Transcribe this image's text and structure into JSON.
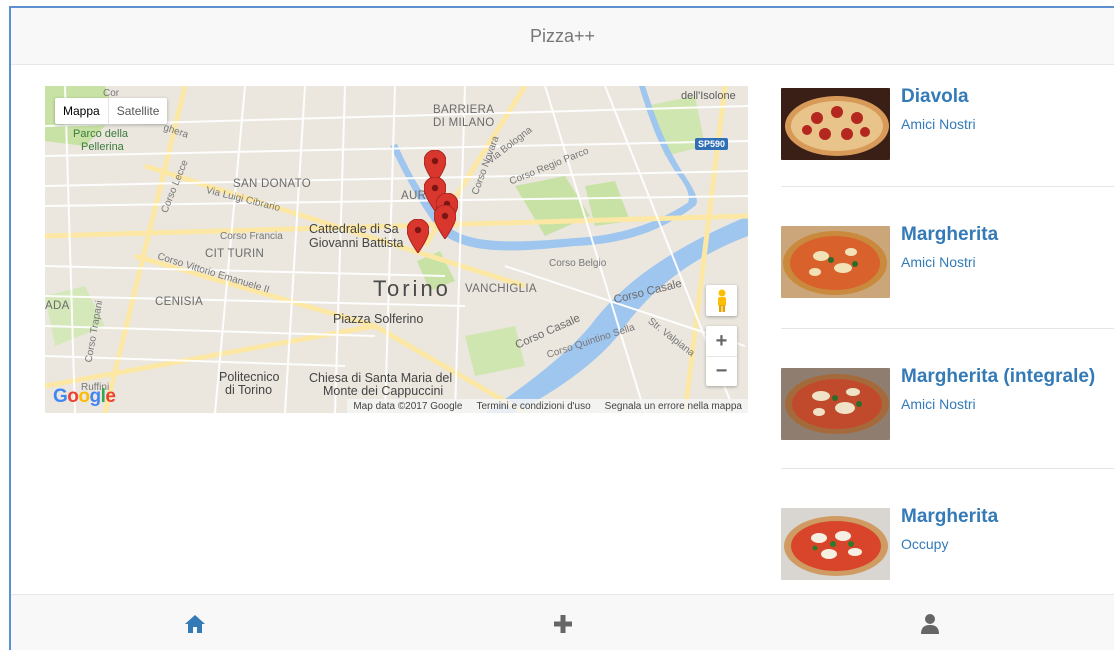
{
  "header": {
    "title": "Pizza++"
  },
  "map": {
    "type_controls": {
      "map_label": "Mappa",
      "satellite_label": "Satellite"
    },
    "zoom": {
      "in": "+",
      "out": "−"
    },
    "attribution": {
      "data": "Map data ©2017 Google",
      "terms": "Termini e condizioni d'uso",
      "report": "Segnala un errore nella mappa"
    },
    "labels": {
      "city": "Torino",
      "barriera": "BARRIERA",
      "di_milano": "DI MILANO",
      "san_donato": "SAN DONATO",
      "aurora": "AURO",
      "cattedrale": "Cattedrale di Sa",
      "giovanni": "Giovanni Battista",
      "cit_turin": "CIT TURIN",
      "cenisia": "CENISIA",
      "vanchiglia": "VANCHIGLIA",
      "piazza_solferino": "Piazza Solferino",
      "politecnico_1": "Politecnico",
      "politecnico_2": "di Torino",
      "chiesa_1": "Chiesa di Santa Maria del",
      "chiesa_2": "Monte dei Cappuccini",
      "parco_1": "Parco della",
      "parco_2": "Pellerina",
      "isolone": "dell'Isolone",
      "sp590": "SP590",
      "corso_lecce": "Corso Lecce",
      "via_luigi_cibrario": "Via Luigi Cibrario",
      "corso_francia": "Corso Francia",
      "corso_vittorio": "Corso Vittorio Emanuele II",
      "corso_trapani": "Corso Trapani",
      "corso_belgio": "Corso Belgio",
      "corso_casale": "Corso Casale",
      "corso_casale_2": "Corso Casale",
      "corso_novara": "Corso Novara",
      "via_bologna": "Via Bologna",
      "corso_regio_parco": "Corso Regio Parco",
      "corso_quintino_sella": "Corso Quintino Sella",
      "str_valpiana": "Str. Valpiana",
      "ada": "ADA",
      "ruffini": "Ruffini",
      "cor": "Cor",
      "ghera": "ghera"
    }
  },
  "pizzas": [
    {
      "name": "Diavola",
      "place": "Amici Nostri"
    },
    {
      "name": "Margherita",
      "place": "Amici Nostri"
    },
    {
      "name": "Margherita (integrale)",
      "place": "Amici Nostri"
    },
    {
      "name": "Margherita",
      "place": "Occupy"
    }
  ],
  "footer": {
    "tabs": [
      {
        "icon": "home-icon"
      },
      {
        "icon": "plus-icon"
      },
      {
        "icon": "user-icon"
      }
    ]
  },
  "colors": {
    "link": "#337ab7",
    "pin": "#d9362e",
    "water": "#9fc6ee",
    "park": "#c8e2a5"
  }
}
